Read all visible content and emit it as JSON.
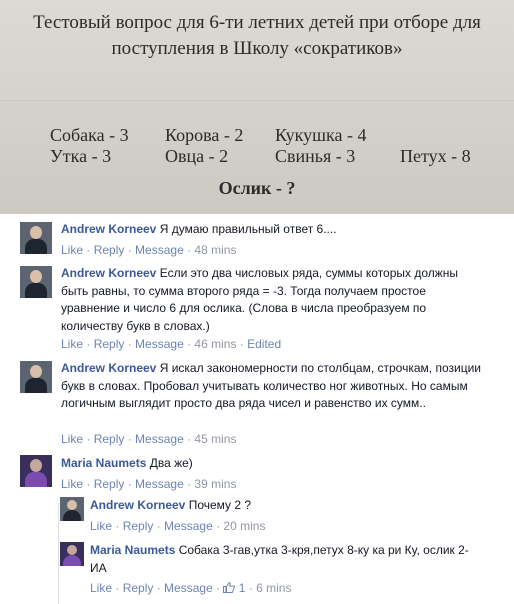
{
  "photo": {
    "title_line1": "Тестовый вопрос для 6-ти летних детей при отборе для",
    "title_line2": "поступления в Школу «сократиков»",
    "row1": [
      "Собака - 3",
      "Корова - 2",
      "Кукушка - 4"
    ],
    "row2": [
      "Утка - 3",
      "Овца - 2",
      "Свинья - 3",
      "Петух - 8"
    ],
    "question": "Ослик - ?"
  },
  "comments": [
    {
      "author": "Andrew Korneev",
      "text": "Я думаю правильный ответ 6....",
      "like": "Like",
      "reply": "Reply",
      "message": "Message",
      "time": "48 mins"
    },
    {
      "author": "Andrew Korneev",
      "text": "Если это два числовых ряда, суммы которых должны быть равны, то сумма второго ряда = -3. Тогда получаем простое уравнение и число 6 для ослика. (Слова в числа преобразуем по количеству букв в словах.)",
      "like": "Like",
      "reply": "Reply",
      "message": "Message",
      "time": "46 mins",
      "edited": "Edited"
    },
    {
      "author": "Andrew Korneev",
      "text": "Я искал закономерности по столбцам, строчкам, позиции букв в словах. Пробовал учитывать количество ног животных. Но самым логичным выглядит просто два ряда чисел и равенство их сумм..",
      "like": "Like",
      "reply": "Reply",
      "message": "Message",
      "time": "45 mins"
    },
    {
      "author": "Maria Naumets",
      "text": "Два же)",
      "like": "Like",
      "reply": "Reply",
      "message": "Message",
      "time": "39 mins"
    },
    {
      "author": "Andrew Korneev",
      "text": "Почему 2 ?",
      "like": "Like",
      "reply": "Reply",
      "message": "Message",
      "time": "20 mins"
    },
    {
      "author": "Maria Naumets",
      "text": "Собака 3-гав,утка 3-кря,петух 8-ку ка ри Ку, ослик 2- ИА",
      "like": "Like",
      "reply": "Reply",
      "message": "Message",
      "like_count": "1",
      "time": "6 mins"
    }
  ],
  "icons": {
    "avatar": "user-avatar",
    "like": "thumbs-up-icon"
  },
  "colors": {
    "author": "#3b5998",
    "link": "#6d84b4",
    "meta": "#9197a3",
    "text": "#141823"
  }
}
